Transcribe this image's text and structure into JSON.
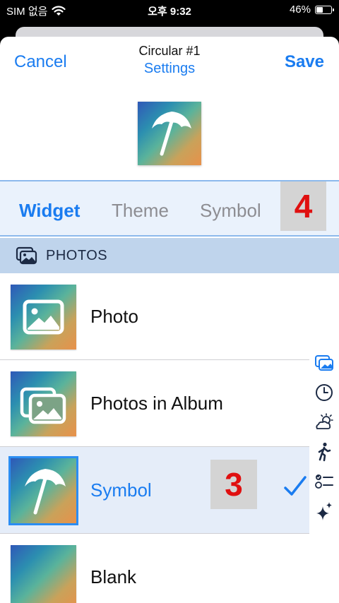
{
  "status": {
    "carrier": "SIM 없음",
    "time": "오후 9:32",
    "battery": "46%",
    "battery_level": 0.46
  },
  "nav": {
    "cancel": "Cancel",
    "title": "Circular #1",
    "subtitle": "Settings",
    "save": "Save"
  },
  "tabs": [
    "Widget",
    "Theme",
    "Symbol"
  ],
  "badges": {
    "tab_badge": "4",
    "row_badge": "3"
  },
  "section": {
    "label": "PHOTOS"
  },
  "rows": [
    {
      "label": "Photo",
      "icon": "photo-icon"
    },
    {
      "label": "Photos in Album",
      "icon": "photos-album-icon"
    },
    {
      "label": "Symbol",
      "icon": "umbrella-icon",
      "selected": true
    },
    {
      "label": "Blank",
      "icon": "blank"
    }
  ],
  "index_icons": [
    "photos-icon",
    "clock-icon",
    "weather-icon",
    "walking-icon",
    "checklist-icon",
    "sparkles-icon"
  ],
  "colors": {
    "accent": "#1a7cf0",
    "badge_text": "#e01010",
    "section_bg": "#bfd4ec"
  }
}
